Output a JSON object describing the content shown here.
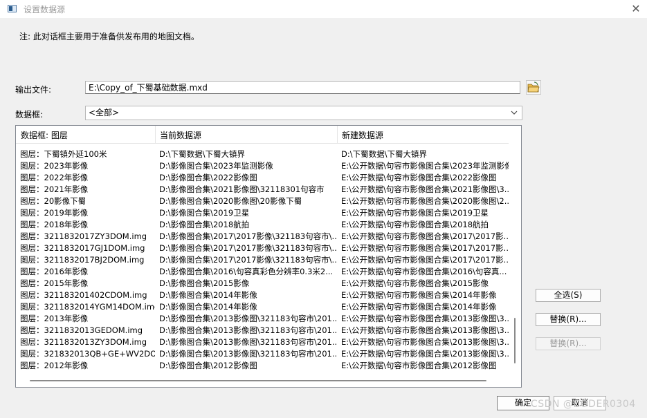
{
  "window": {
    "title": "设置数据源"
  },
  "note": "注: 此对话框主要用于准备供发布用的地图文档。",
  "output": {
    "label": "输出文件:",
    "value": "E:\\Copy_of_下蜀基础数据.mxd"
  },
  "frame": {
    "label": "数据框:",
    "value": "<全部>"
  },
  "list": {
    "headers": [
      "数据框: 图层",
      "当前数据源",
      "新建数据源"
    ],
    "rows": [
      [
        "图层：下蜀镇外延100米",
        "D:\\下蜀数据\\下蜀大镇界",
        "D:\\下蜀数据\\下蜀大镇界"
      ],
      [
        "图层：2023年影像",
        "D:\\影像图合集\\2023年监测影像",
        "E:\\公开数据\\句容市影像图合集\\2023年监测影像"
      ],
      [
        "图层：2022年影像",
        "D:\\影像图合集\\2022影像图",
        "E:\\公开数据\\句容市影像图合集\\2022影像图"
      ],
      [
        "图层：2021年影像",
        "D:\\影像图合集\\2021影像图\\32118301句容市",
        "E:\\公开数据\\句容市影像图合集\\2021影像图\\3..."
      ],
      [
        "图层：20影像下蜀",
        "D:\\影像图合集\\2020影像图\\20影像下蜀",
        "E:\\公开数据\\句容市影像图合集\\2020影像图\\2..."
      ],
      [
        "图层：2019年影像",
        "D:\\影像图合集\\2019卫星",
        "E:\\公开数据\\句容市影像图合集\\2019卫星"
      ],
      [
        "图层：2018年影像",
        "D:\\影像图合集\\2018航拍",
        "E:\\公开数据\\句容市影像图合集\\2018航拍"
      ],
      [
        "图层：3211832017ZY3DOM.img",
        "D:\\影像图合集\\2017\\2017影像\\321183句容市\\...",
        "E:\\公开数据\\句容市影像图合集\\2017\\2017影..."
      ],
      [
        "图层：3211832017GJ1DOM.img",
        "D:\\影像图合集\\2017\\2017影像\\321183句容市\\...",
        "E:\\公开数据\\句容市影像图合集\\2017\\2017影..."
      ],
      [
        "图层：3211832017BJ2DOM.img",
        "D:\\影像图合集\\2017\\2017影像\\321183句容市\\...",
        "E:\\公开数据\\句容市影像图合集\\2017\\2017影..."
      ],
      [
        "图层：2016年影像",
        "D:\\影像图合集\\2016\\句容真彩色分辨率0.3米2...",
        "E:\\公开数据\\句容市影像图合集\\2016\\句容真..."
      ],
      [
        "图层：2015年影像",
        "D:\\影像图合集\\2015影像",
        "E:\\公开数据\\句容市影像图合集\\2015影像"
      ],
      [
        "图层：321183201402CDOM.img",
        "D:\\影像图合集\\2014年影像",
        "E:\\公开数据\\句容市影像图合集\\2014年影像"
      ],
      [
        "图层：3211832014YGM14DOM.img",
        "D:\\影像图合集\\2014年影像",
        "E:\\公开数据\\句容市影像图合集\\2014年影像"
      ],
      [
        "图层：2013年影像",
        "D:\\影像图合集\\2013影像图\\321183句容市\\201...",
        "E:\\公开数据\\句容市影像图合集\\2013影像图\\3..."
      ],
      [
        "图层：3211832013GEDOM.img",
        "D:\\影像图合集\\2013影像图\\321183句容市\\201...",
        "E:\\公开数据\\句容市影像图合集\\2013影像图\\3..."
      ],
      [
        "图层：3211832013ZY3DOM.img",
        "D:\\影像图合集\\2013影像图\\321183句容市\\201...",
        "E:\\公开数据\\句容市影像图合集\\2013影像图\\3..."
      ],
      [
        "图层：321832013QB+GE+WV2DOM....",
        "D:\\影像图合集\\2013影像图\\321183句容市\\201...",
        "E:\\公开数据\\句容市影像图合集\\2013影像图\\3..."
      ],
      [
        "图层：2012年影像",
        "D:\\影像图合集\\2012影像图",
        "E:\\公开数据\\句容市影像图合集\\2012影像图"
      ]
    ]
  },
  "buttons": {
    "select_all": "全选(S)",
    "replace": "替换(R)...",
    "replace_disabled": "替换(R)...",
    "ok": "确定",
    "cancel": "取消"
  },
  "watermark": "CSDN @CODER0304",
  "icons": {
    "app": "dialog-app-icon",
    "close": "close-icon",
    "browse": "open-folder-icon",
    "dropdown": "chevron-down-icon"
  },
  "colors": {
    "dialog_bg": "#f0f0f0",
    "list_bg": "#ffffff",
    "folder_yellow": "#e8b94a"
  }
}
